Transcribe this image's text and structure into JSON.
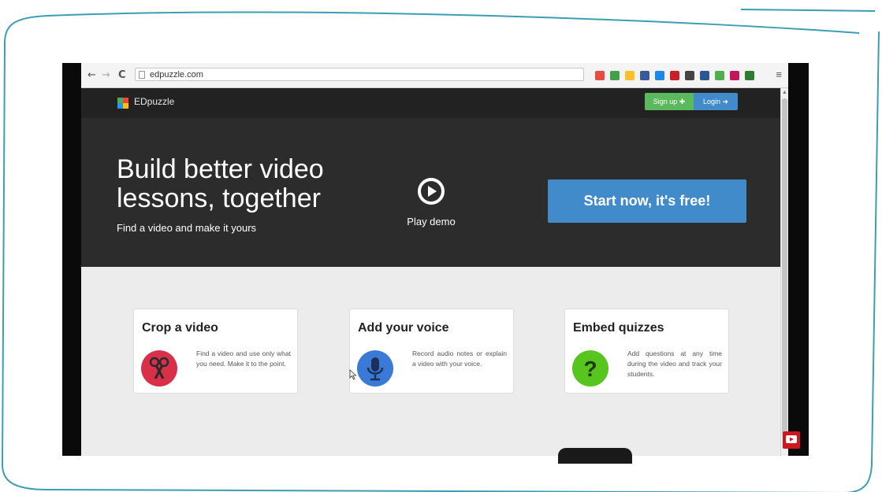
{
  "browser": {
    "url": "edpuzzle.com",
    "nav": {
      "back": "←",
      "forward": "→",
      "reload": "C"
    },
    "menu_glyph": "≡",
    "extension_colors": [
      "#e74c3c",
      "#43a047",
      "#fbc02d",
      "#3b5998",
      "#1e88e5",
      "#cb2027",
      "#444444",
      "#2b5797",
      "#4caf50",
      "#c2185b",
      "#2e7d32"
    ]
  },
  "site": {
    "logo_text": "EDpuzzle",
    "signup_label": "Sign up ✚",
    "login_label": "Login ➜",
    "colors": {
      "signup": "#5cb85c",
      "login": "#428bca",
      "hero_bg": "#2c2c2c",
      "nav_bg": "#222222"
    }
  },
  "hero": {
    "title": "Build better video lessons, together",
    "subtitle": "Find a video and make it yours",
    "play_label": "Play demo",
    "cta_label": "Start now, it's free!"
  },
  "features": [
    {
      "title": "Crop a video",
      "description": "Find a video and use only what you need. Make it to the point.",
      "icon": "scissors-icon",
      "color": "#d9304a"
    },
    {
      "title": "Add your voice",
      "description": "Record audio notes or explain a video with your voice.",
      "icon": "microphone-icon",
      "color": "#3a7ad6"
    },
    {
      "title": "Embed quizzes",
      "description": "Add questions at any time during the video and track your students.",
      "icon": "question-icon",
      "color": "#57c51e"
    }
  ]
}
